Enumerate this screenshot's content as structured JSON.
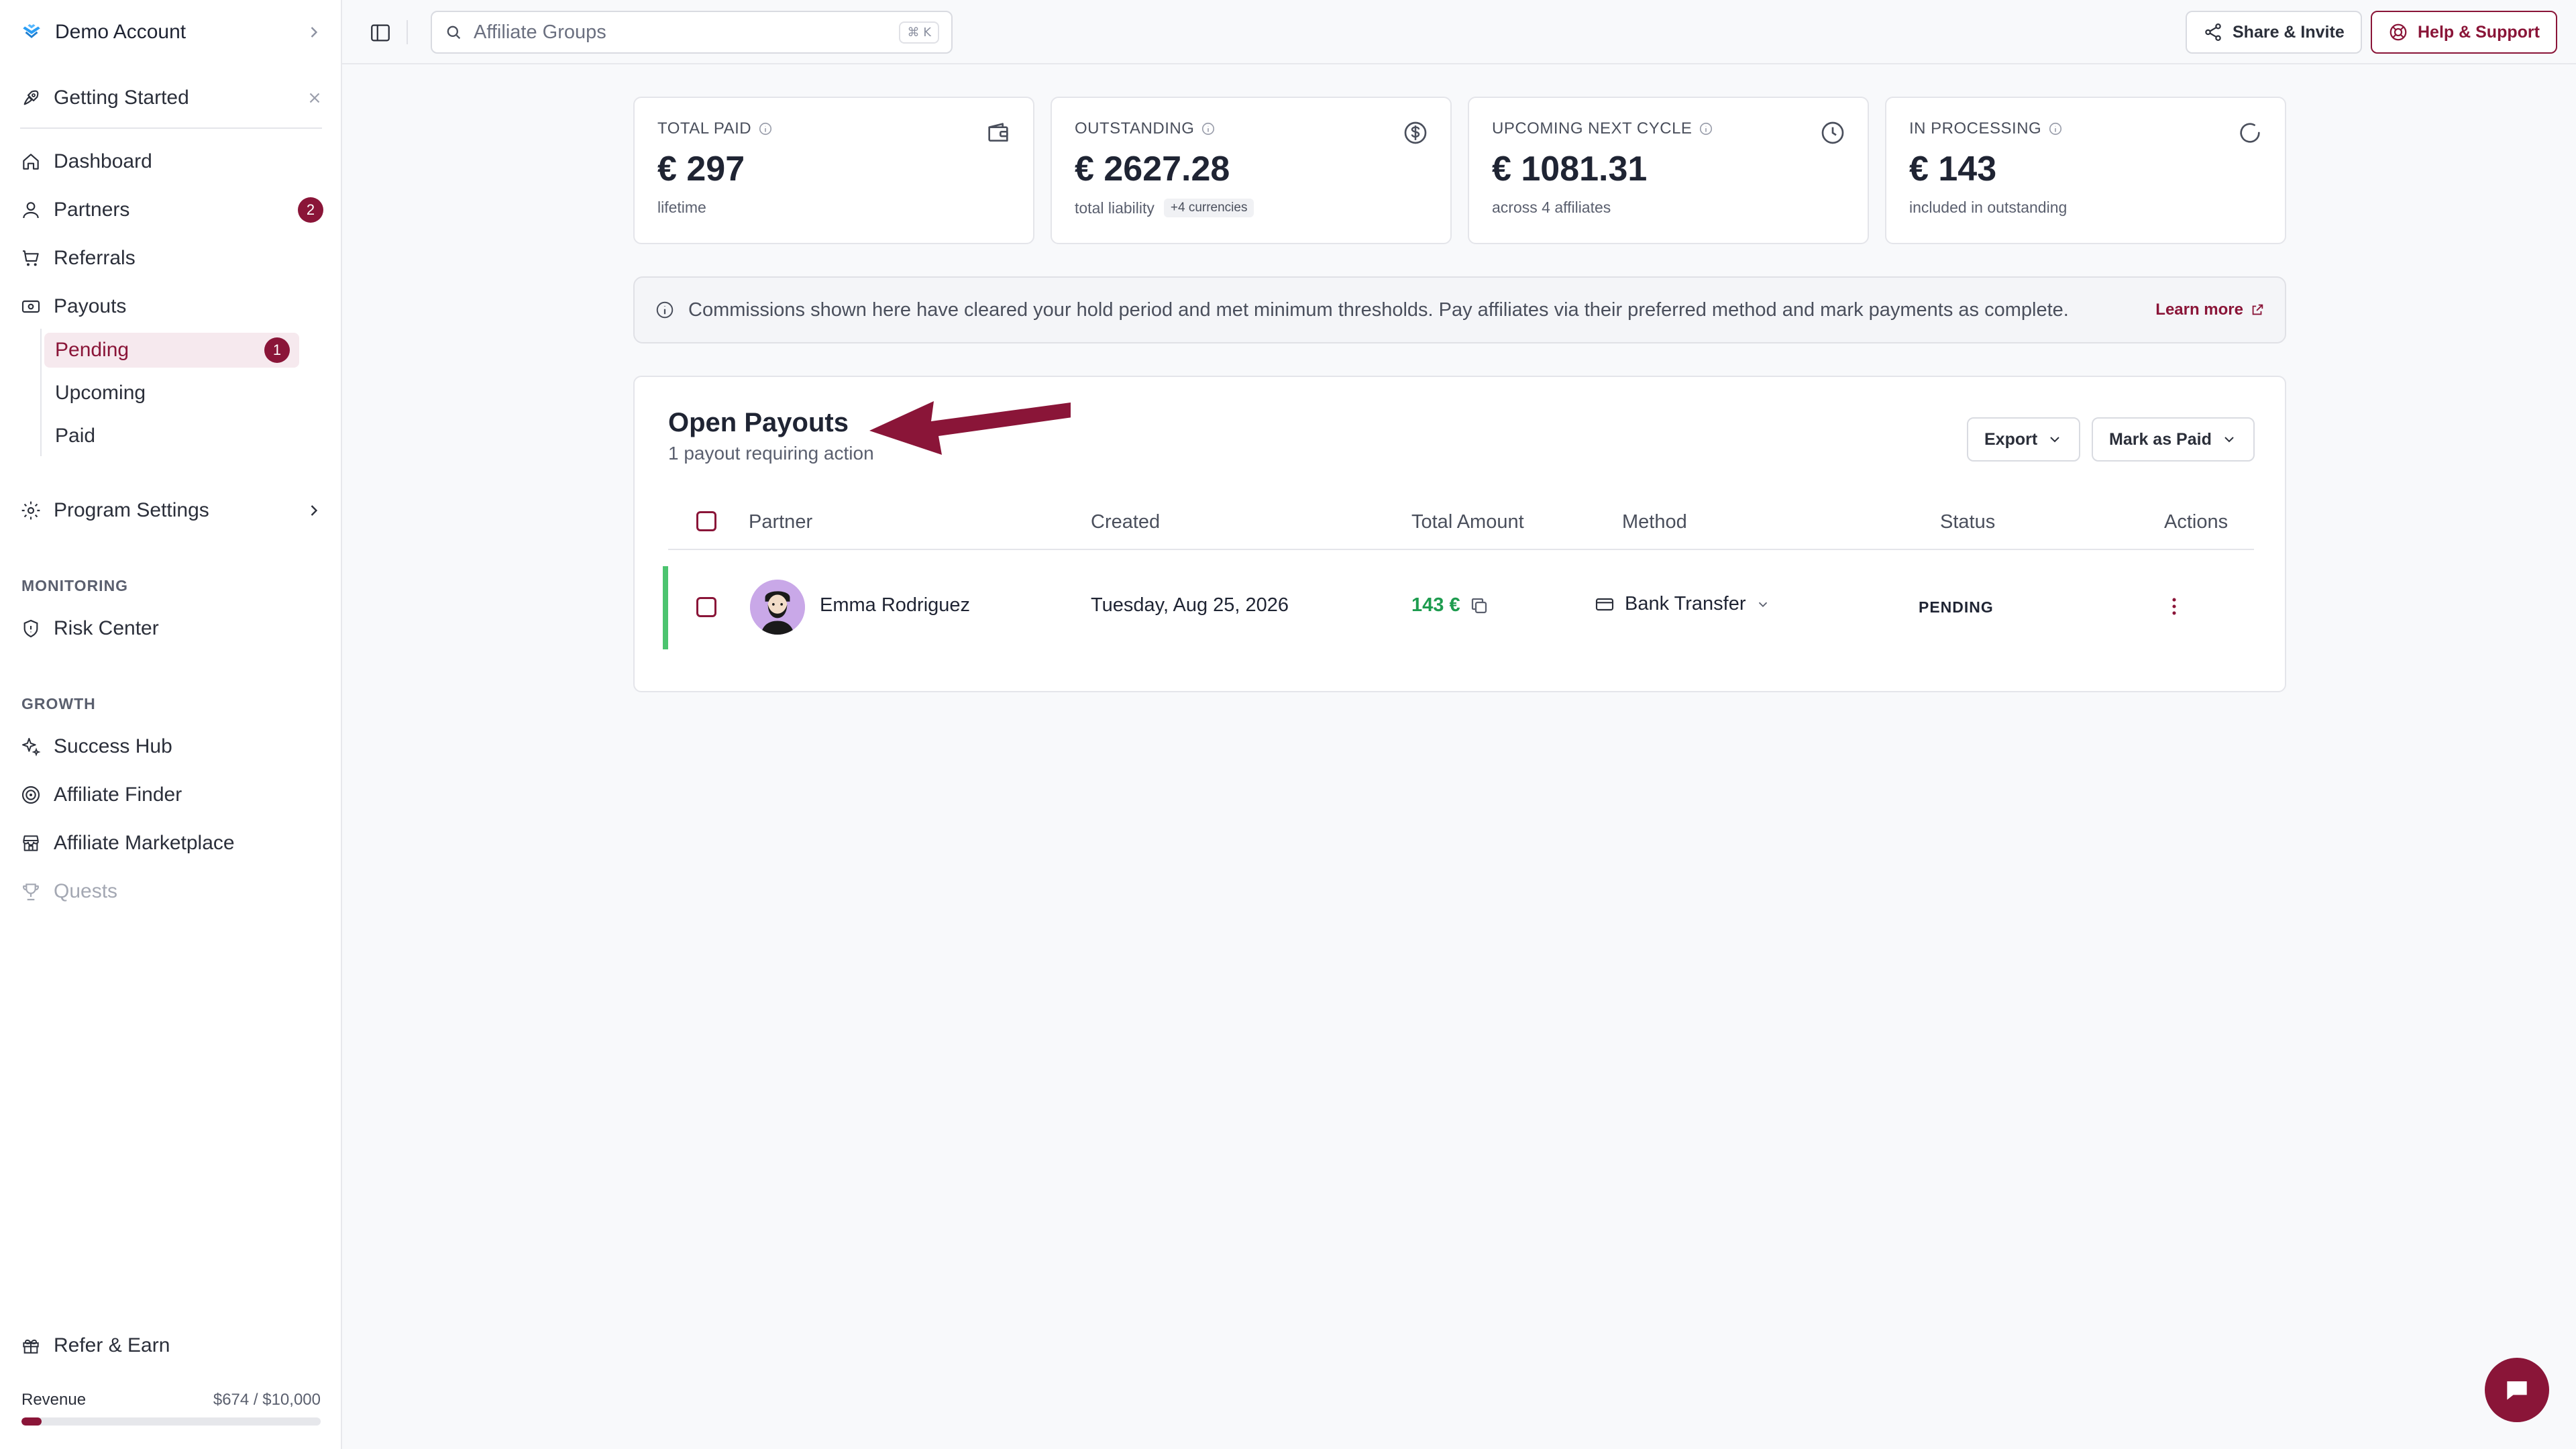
{
  "sidebar": {
    "account_name": "Demo Account",
    "getting_started": "Getting Started",
    "nav": [
      {
        "label": "Dashboard",
        "icon": "home-icon"
      },
      {
        "label": "Partners",
        "icon": "user-icon",
        "badge": "2"
      },
      {
        "label": "Referrals",
        "icon": "cart-icon"
      },
      {
        "label": "Payouts",
        "icon": "banknote-icon"
      }
    ],
    "payouts_sub": [
      {
        "label": "Pending",
        "badge": "1",
        "active": true
      },
      {
        "label": "Upcoming"
      },
      {
        "label": "Paid"
      }
    ],
    "program_settings": "Program Settings",
    "monitoring_label": "MONITORING",
    "risk_center": "Risk Center",
    "growth_label": "GROWTH",
    "growth_items": [
      {
        "label": "Success Hub",
        "icon": "sparkles-icon"
      },
      {
        "label": "Affiliate Finder",
        "icon": "target-icon"
      },
      {
        "label": "Affiliate Marketplace",
        "icon": "store-icon"
      },
      {
        "label": "Quests",
        "icon": "trophy-icon",
        "disabled": true
      }
    ],
    "refer_earn": "Refer & Earn",
    "revenue": {
      "label": "Revenue",
      "value_text": "$674 / $10,000",
      "progress": 0.0674
    }
  },
  "topbar": {
    "search_placeholder": "Affiliate Groups",
    "search_shortcut": "⌘ K",
    "share_label": "Share & Invite",
    "help_label": "Help & Support"
  },
  "stats": [
    {
      "label": "TOTAL PAID",
      "value": "€ 297",
      "sub": "lifetime",
      "icon": "wallet-icon"
    },
    {
      "label": "OUTSTANDING",
      "value": "€ 2627.28",
      "sub": "total liability",
      "chip": "+4 currencies",
      "icon": "dollar-circle-icon"
    },
    {
      "label": "UPCOMING NEXT CYCLE",
      "value": "€ 1081.31",
      "sub": "across 4 affiliates",
      "icon": "clock-icon"
    },
    {
      "label": "IN PROCESSING",
      "value": "€ 143",
      "sub": "included in outstanding",
      "icon": "loader-icon"
    }
  ],
  "banner": {
    "text": "Commissions shown here have cleared your hold period and met minimum thresholds. Pay affiliates via their preferred method and mark payments as complete.",
    "link": "Learn more"
  },
  "payouts": {
    "title": "Open Payouts",
    "subtitle": "1 payout requiring action",
    "export_label": "Export",
    "mark_paid_label": "Mark as Paid",
    "columns": [
      "Partner",
      "Created",
      "Total Amount",
      "Method",
      "Status",
      "Actions"
    ],
    "rows": [
      {
        "partner": "Emma Rodriguez",
        "created": "Tuesday, Aug 25, 2026",
        "amount": "143 €",
        "method": "Bank Transfer",
        "status": "PENDING"
      }
    ]
  },
  "colors": {
    "brand": "#8a1538",
    "success": "#1e9c4f",
    "row_accent": "#4cc46f"
  }
}
